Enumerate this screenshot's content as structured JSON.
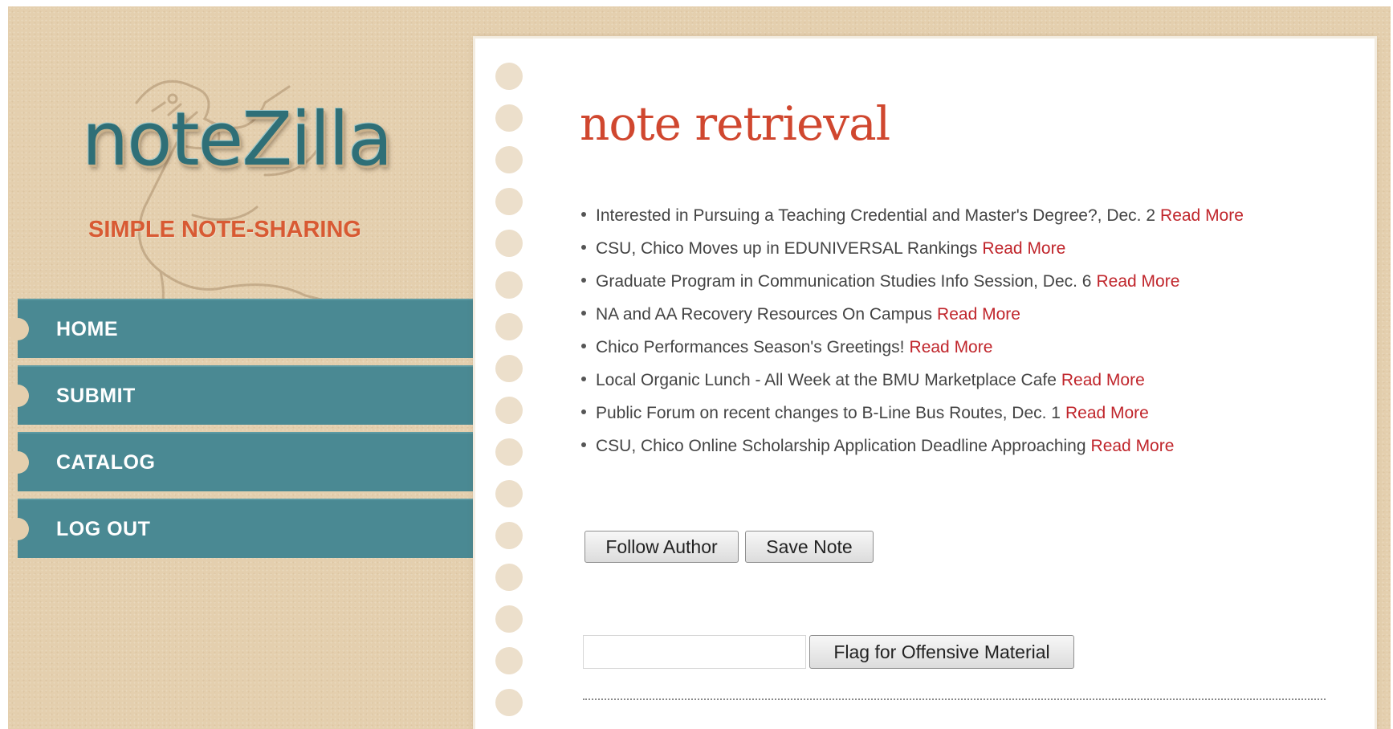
{
  "brand": {
    "logo_text": "noteZilla",
    "tagline": "SIMPLE NOTE-SHARING"
  },
  "nav": {
    "items": [
      {
        "label": "HOME"
      },
      {
        "label": "SUBMIT"
      },
      {
        "label": "CATALOG"
      },
      {
        "label": "LOG OUT"
      }
    ]
  },
  "main": {
    "title": "note retrieval",
    "read_more_label": "Read More",
    "news": [
      {
        "text": "Interested in Pursuing a Teaching Credential and Master's Degree?, Dec. 2"
      },
      {
        "text": "CSU, Chico Moves up in EDUNIVERSAL Rankings"
      },
      {
        "text": "Graduate Program in Communication Studies Info Session, Dec. 6"
      },
      {
        "text": "NA and AA Recovery Resources On Campus"
      },
      {
        "text": "Chico Performances Season's Greetings!"
      },
      {
        "text": "Local Organic Lunch - All Week at the BMU Marketplace Cafe"
      },
      {
        "text": "Public Forum on recent changes to B-Line Bus Routes, Dec. 1"
      },
      {
        "text": "CSU, Chico Online Scholarship Application Deadline Approaching"
      }
    ],
    "follow_label": "Follow Author",
    "save_label": "Save Note",
    "flag_input_value": "",
    "flag_label": "Flag for Offensive Material"
  },
  "colors": {
    "background": "#e4cfae",
    "nav": "#4a8993",
    "title": "#d0472f",
    "link": "#c0252b",
    "tagline": "#d85a33"
  },
  "icons": {
    "mascot": "dinosaur-sketch-icon",
    "bullet": "bullet-icon"
  }
}
